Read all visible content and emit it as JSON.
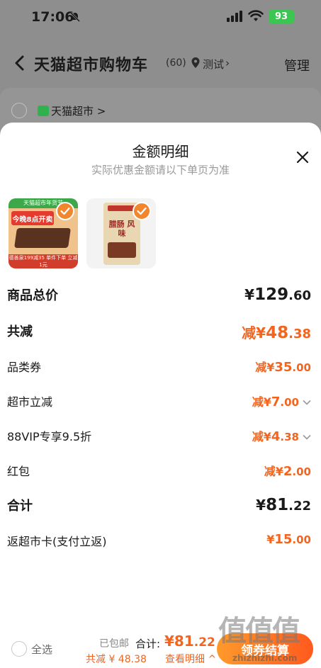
{
  "status_bar": {
    "time": "17:06",
    "battery": "93"
  },
  "nav": {
    "title": "天猫超市购物车",
    "count": "(60)",
    "location": "测试",
    "manage": "管理"
  },
  "store": {
    "name": "天猫超市 >"
  },
  "sheet": {
    "title": "金额明细",
    "subtitle": "实际优惠金额请以下单页为准",
    "thumb1": {
      "top_text": "天猫超市年货节",
      "promo": "今晚8点开卖",
      "bottom_text": "德善泉199减35 单件下单 立减1元",
      "tag": "王品烘焙"
    },
    "thumb2": {
      "name": "腊肠 风味"
    },
    "rows": {
      "goods_total": {
        "label": "商品总价",
        "prefix": "¥",
        "int": "129",
        "dec": ".60"
      },
      "total_reduce": {
        "label": "共减",
        "prefix": "减¥",
        "int": "48",
        "dec": ".38"
      },
      "category_coupon": {
        "label": "品类券",
        "prefix": "减¥",
        "int": "35",
        "dec": ".00"
      },
      "market_reduce": {
        "label": "超市立减",
        "prefix": "减¥",
        "int": "7",
        "dec": ".00"
      },
      "vip_discount": {
        "label": "88VIP专享9.5折",
        "prefix": "减¥",
        "int": "4",
        "dec": ".38"
      },
      "red_packet": {
        "label": "红包",
        "prefix": "减¥",
        "int": "2",
        "dec": ".00"
      },
      "sum": {
        "label": "合计",
        "prefix": "¥",
        "int": "81",
        "dec": ".22"
      },
      "card_rebate": {
        "label": "返超市卡(支付立返)",
        "prefix": "¥",
        "int": "15",
        "dec": ".00"
      }
    }
  },
  "bottom": {
    "select_all": "全选",
    "free_shipping": "已包邮",
    "total_label": "合计:",
    "total_prefix": "¥",
    "total_int": "81",
    "total_dec": ".22",
    "discount_text": "共减 ¥ 48.38",
    "see_detail": "查看明细 ^",
    "checkout": "领券结算"
  },
  "watermark": {
    "big": "值值值",
    "small": "zhizhizhi.com"
  },
  "colors": {
    "accent": "#f3641e",
    "check": "#f2862c",
    "button_start": "#ff9a2b",
    "button_end": "#ff5a1e"
  }
}
